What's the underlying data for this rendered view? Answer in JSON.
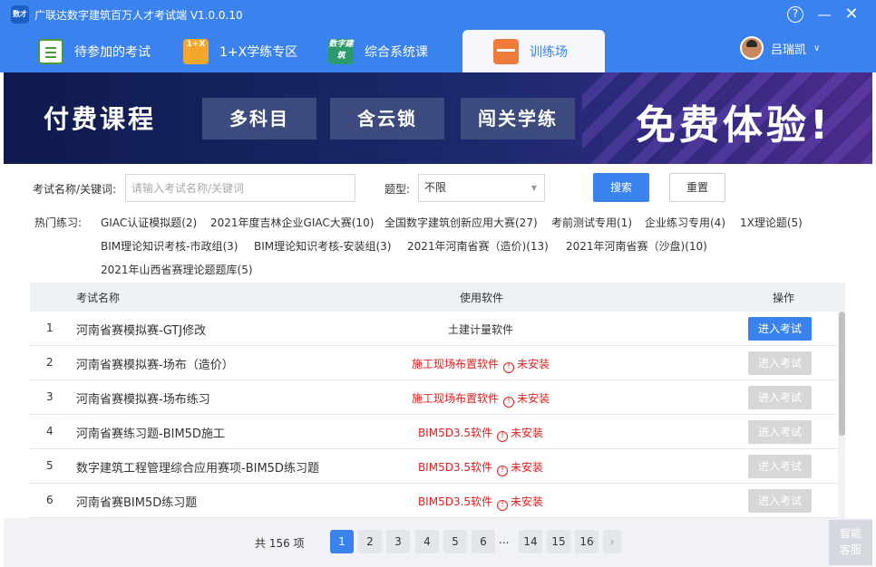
{
  "app": {
    "logo_text": "数才",
    "title": "广联达数字建筑百万人才考试端 V1.0.0.10",
    "help_symbol": "?",
    "minimize_symbol": "—",
    "close_symbol": "✕"
  },
  "nav": {
    "tabs": [
      {
        "label": "待参加的考试",
        "icon": "clipboard-icon",
        "icon_text": ""
      },
      {
        "label": "1+X学练专区",
        "icon": "calculator-icon",
        "icon_text": "1+X"
      },
      {
        "label": "综合系统课",
        "icon": "digital-building-icon",
        "icon_text": "数字建筑"
      },
      {
        "label": "训练场",
        "icon": "toolbox-icon",
        "icon_text": ""
      }
    ],
    "active_tab": "训练场",
    "user_name": "吕瑞凯",
    "user_chevron": "∨"
  },
  "banner": {
    "title": "付费课程",
    "chips": [
      "多科目",
      "含云锁",
      "闯关学练"
    ],
    "cta": "免费体验!"
  },
  "filter": {
    "keyword_label": "考试名称/关键词:",
    "keyword_placeholder": "请输入考试名称/关键词",
    "keyword_value": "",
    "type_label": "题型:",
    "type_value": "不限",
    "search_button": "搜索",
    "reset_button": "重置"
  },
  "hot": {
    "label": "热门练习:",
    "tags": [
      "GIAC认证模拟题(2)",
      "2021年度吉林企业GIAC大赛(10)",
      "全国数字建筑创新应用大赛(27)",
      "考前测试专用(1)",
      "企业练习专用(4)",
      "1X理论题(5)",
      "BIM理论知识考核-市政组(3)",
      "BIM理论知识考核-安装组(3)",
      "2021年河南省赛（造价)(13)",
      "2021年河南省赛（沙盘)(10)",
      "2021年山西省赛理论题题库(5)"
    ]
  },
  "table": {
    "headers": {
      "name": "考试名称",
      "software": "使用软件",
      "action": "操作"
    },
    "rows": [
      {
        "no": "1",
        "name": "河南省赛模拟赛-GTJ修改",
        "software": "土建计量软件",
        "status": "",
        "action": "进入考试",
        "enabled": true
      },
      {
        "no": "2",
        "name": "河南省赛模拟赛-场布（造价）",
        "software": "施工现场布置软件",
        "status": "未安装",
        "action": "进入考试",
        "enabled": false
      },
      {
        "no": "3",
        "name": "河南省赛模拟赛-场布练习",
        "software": "施工现场布置软件",
        "status": "未安装",
        "action": "进入考试",
        "enabled": false
      },
      {
        "no": "4",
        "name": "河南省赛练习题-BIM5D施工",
        "software": "BIM5D3.5软件",
        "status": "未安装",
        "action": "进入考试",
        "enabled": false
      },
      {
        "no": "5",
        "name": "数字建筑工程管理综合应用赛项-BIM5D练习题",
        "software": "BIM5D3.5软件",
        "status": "未安装",
        "action": "进入考试",
        "enabled": false
      },
      {
        "no": "6",
        "name": "河南省赛BIM5D练习题",
        "software": "BIM5D3.5软件",
        "status": "未安装",
        "action": "进入考试",
        "enabled": false
      }
    ]
  },
  "pagination": {
    "total": "共 156 项",
    "pages": [
      "1",
      "2",
      "3",
      "4",
      "5",
      "6"
    ],
    "ellipsis": "...",
    "tail_pages": [
      "14",
      "15",
      "16"
    ],
    "current": "1",
    "next_symbol": "›"
  },
  "support": {
    "line1": "智能",
    "line2": "客服"
  },
  "colors": {
    "primary": "#3a82ee",
    "danger": "#e02020",
    "disabled": "#d7d7d7"
  }
}
